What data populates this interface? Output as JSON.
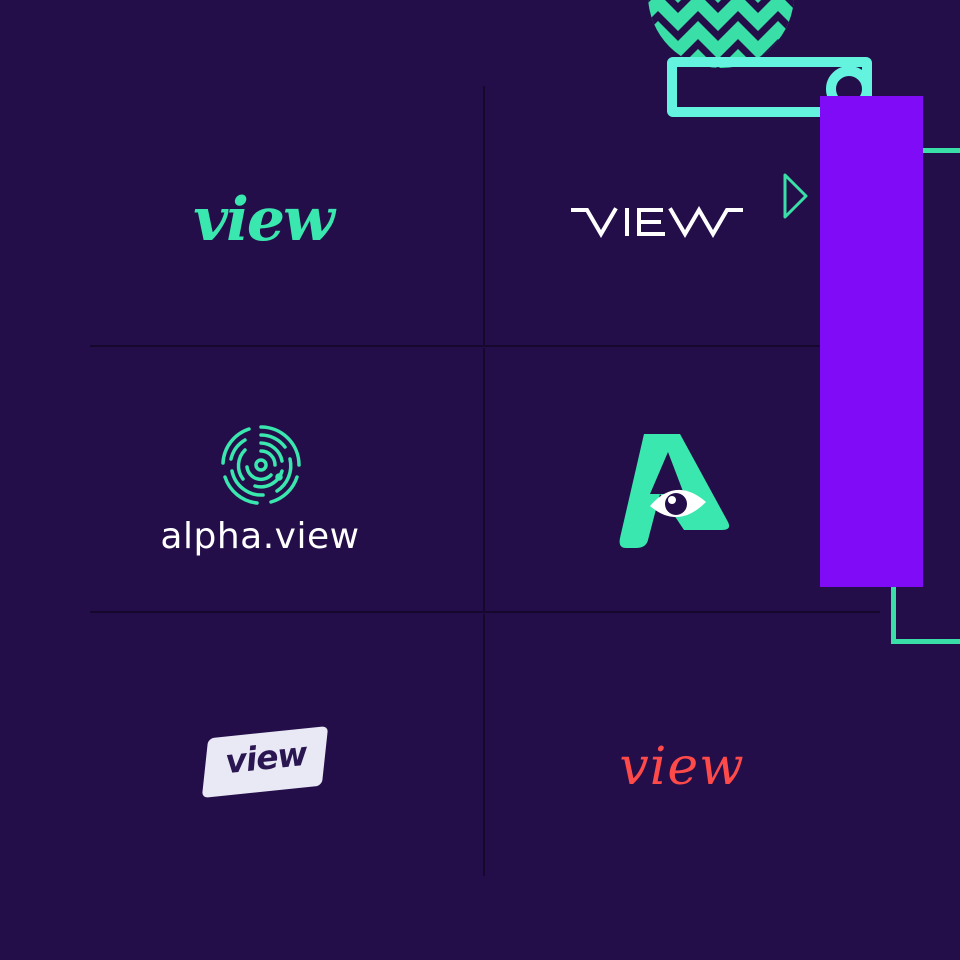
{
  "logos": {
    "script_green": {
      "text": "view"
    },
    "techno": {
      "text": "VIEW"
    },
    "alpha": {
      "wordmark": "alpha.view"
    },
    "a_eye": {
      "letter": "A"
    },
    "badge": {
      "text": "view"
    },
    "script_red": {
      "text": "view"
    }
  },
  "colors": {
    "background": "#240e4a",
    "divider": "#15072e",
    "mint": "#3ae7ae",
    "aqua": "#63f3df",
    "violet": "#7f0bf7",
    "white": "#ffffff",
    "badge_fill": "#e9e8f5",
    "badge_text": "#2a1752",
    "coral": "#ff4a4a"
  },
  "icons": {
    "zigzag": "zigzag-circle-icon",
    "triangle": "play-triangle-icon",
    "fingerprint": "fingerprint-icon",
    "eye": "eye-icon"
  }
}
